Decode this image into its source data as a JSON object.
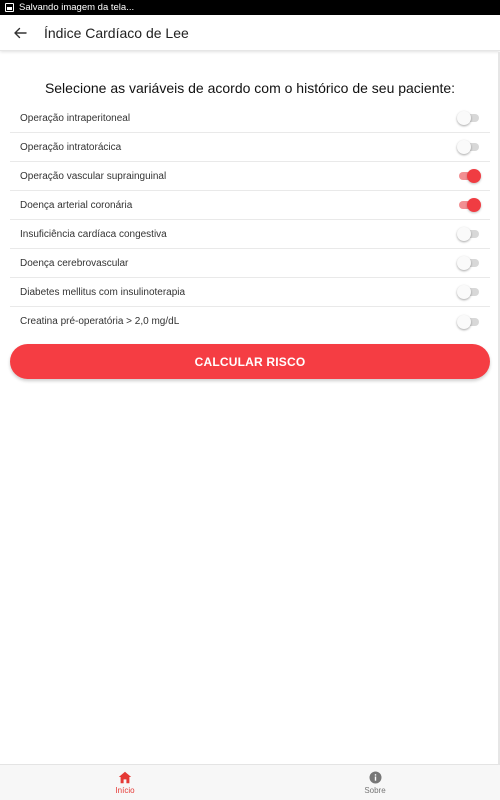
{
  "status_bar": {
    "text": "Salvando imagem da tela..."
  },
  "header": {
    "title": "Índice Cardíaco de Lee"
  },
  "main": {
    "heading": "Selecione as variáveis de acordo com o histórico de seu paciente:",
    "options": [
      {
        "label": "Operação intraperitoneal",
        "checked": false
      },
      {
        "label": "Operação intratorácica",
        "checked": false
      },
      {
        "label": "Operação vascular suprainguinal",
        "checked": true
      },
      {
        "label": "Doença arterial coronária",
        "checked": true
      },
      {
        "label": "Insuficiência cardíaca congestiva",
        "checked": false
      },
      {
        "label": "Doença cerebrovascular",
        "checked": false
      },
      {
        "label": "Diabetes mellitus com insulinoterapia",
        "checked": false
      },
      {
        "label": "Creatina pré-operatória > 2,0 mg/dL",
        "checked": false
      }
    ],
    "calculate_label": "CALCULAR RISCO"
  },
  "bottom_nav": {
    "items": [
      {
        "label": "Início",
        "icon": "home-icon",
        "active": true
      },
      {
        "label": "Sobre",
        "icon": "info-icon",
        "active": false
      }
    ]
  },
  "colors": {
    "accent": "#f53d43",
    "toggle_on_thumb": "#f03c42",
    "toggle_on_track": "#f28f92",
    "nav_active": "#e53935",
    "nav_inactive": "#777777"
  }
}
